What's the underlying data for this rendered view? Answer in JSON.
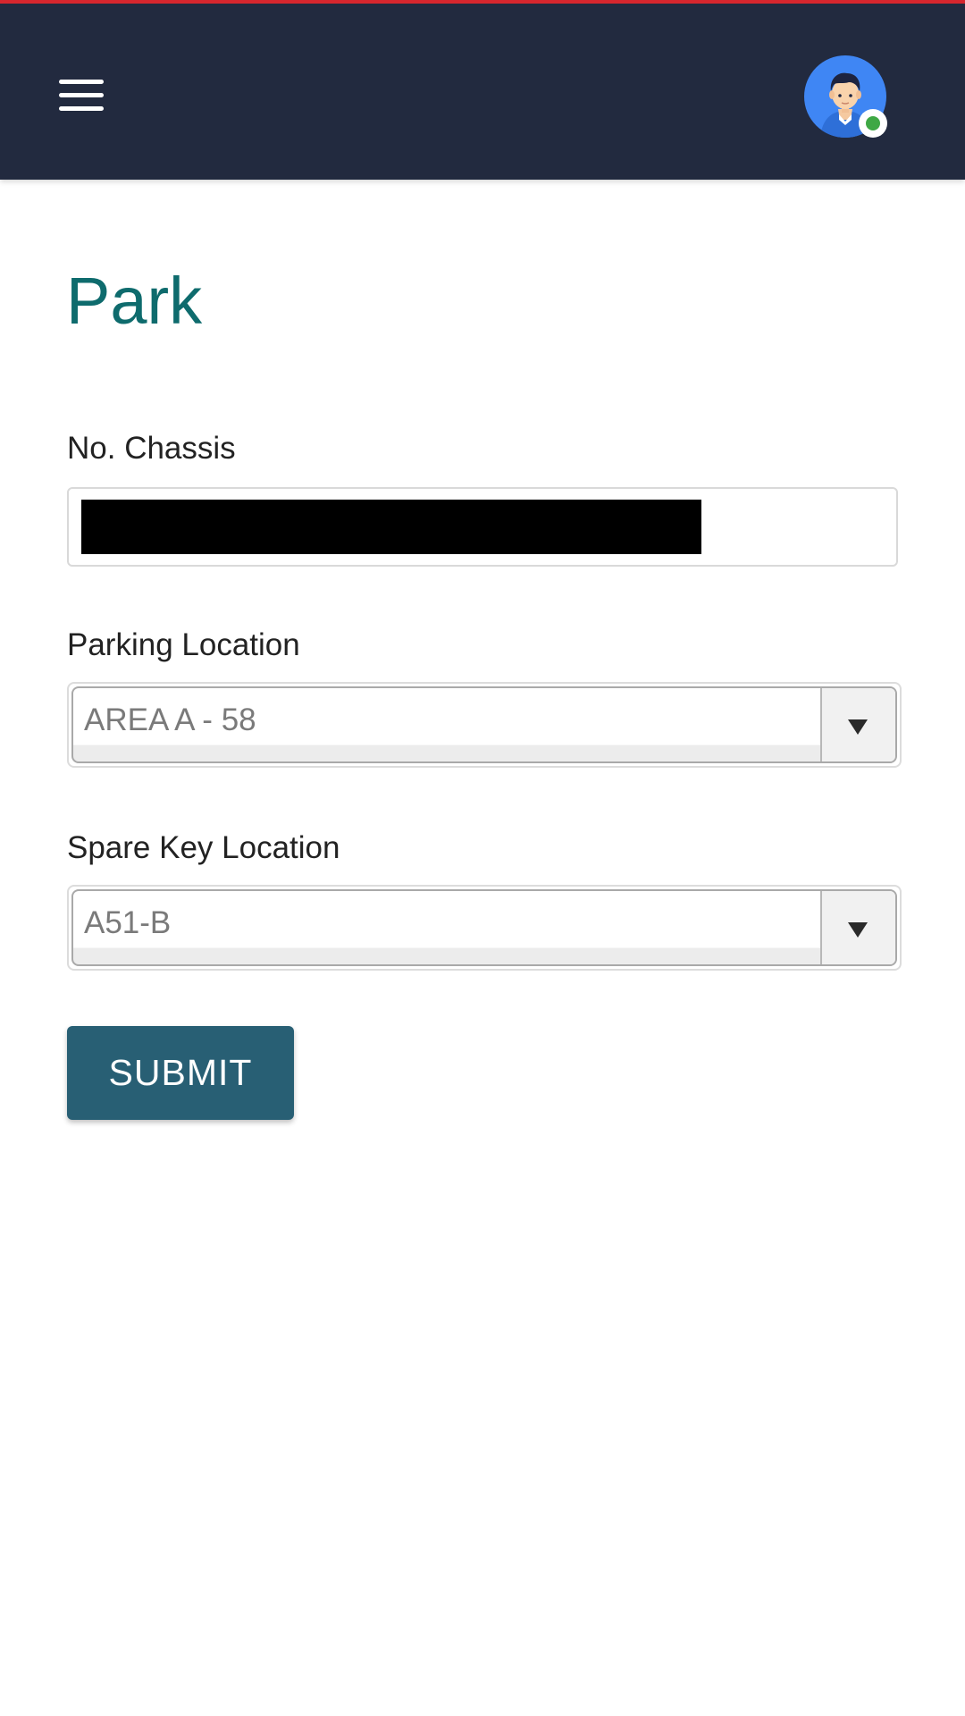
{
  "header": {
    "menu_icon": "hamburger-menu-icon",
    "avatar_icon": "user-avatar-icon",
    "status": "online",
    "colors": {
      "background": "#222a3f",
      "top_accent": "#d7262e",
      "avatar": "#3f86f4",
      "status_online": "#3fa845"
    }
  },
  "page": {
    "title": "Park",
    "title_color": "#0e6b6d"
  },
  "form": {
    "chassis": {
      "label": "No. Chassis",
      "value_redacted": true
    },
    "parking_location": {
      "label": "Parking Location",
      "selected": "AREA A - 58"
    },
    "spare_key_location": {
      "label": "Spare Key Location",
      "selected": "A51-B"
    },
    "submit": {
      "label": "SUBMIT",
      "color": "#285f74"
    }
  }
}
